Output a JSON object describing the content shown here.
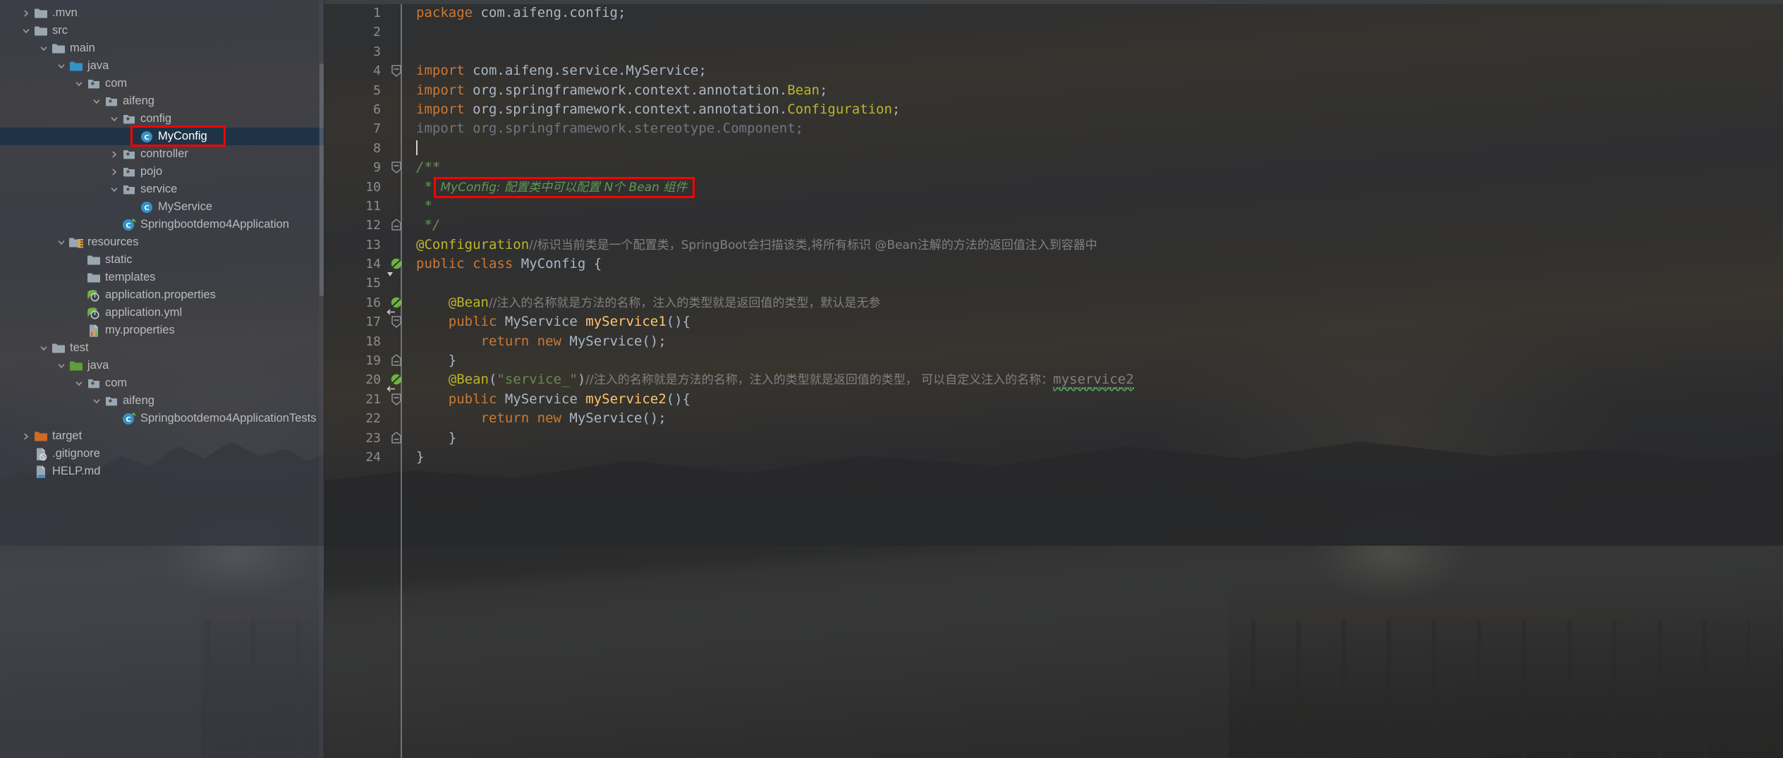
{
  "theme": {
    "sidebar_bg": "#3c3f47",
    "editor_bg": "#2b2b2b",
    "selection_bg": "#1f3347",
    "highlight_box": "#ff0000",
    "keyword": "#cc7832",
    "annotation": "#bbb529",
    "string": "#6a8759",
    "javadoc": "#629755",
    "comment": "#808080",
    "method": "#ffc66d",
    "identifier": "#a9b7c6",
    "line_number": "#8d8d8d"
  },
  "sidebar": {
    "name": "project-tree",
    "scrollbar": "visible",
    "items": [
      {
        "label": ".mvn",
        "indent": 1,
        "arrow": "collapsed",
        "icon": "folder-grey",
        "selected": false
      },
      {
        "label": "src",
        "indent": 1,
        "arrow": "expanded",
        "icon": "folder-grey",
        "selected": false
      },
      {
        "label": "main",
        "indent": 2,
        "arrow": "expanded",
        "icon": "folder-grey",
        "selected": false
      },
      {
        "label": "java",
        "indent": 3,
        "arrow": "expanded",
        "icon": "folder-blue",
        "selected": false
      },
      {
        "label": "com",
        "indent": 4,
        "arrow": "expanded",
        "icon": "package",
        "selected": false
      },
      {
        "label": "aifeng",
        "indent": 5,
        "arrow": "expanded",
        "icon": "package",
        "selected": false
      },
      {
        "label": "config",
        "indent": 6,
        "arrow": "expanded",
        "icon": "package",
        "selected": false
      },
      {
        "label": "MyConfig",
        "indent": 7,
        "arrow": "none",
        "icon": "java-class",
        "selected": true
      },
      {
        "label": "controller",
        "indent": 6,
        "arrow": "collapsed",
        "icon": "package",
        "selected": false
      },
      {
        "label": "pojo",
        "indent": 6,
        "arrow": "collapsed",
        "icon": "package",
        "selected": false
      },
      {
        "label": "service",
        "indent": 6,
        "arrow": "expanded",
        "icon": "package",
        "selected": false
      },
      {
        "label": "MyService",
        "indent": 7,
        "arrow": "none",
        "icon": "java-class",
        "selected": false
      },
      {
        "label": "Springbootdemo4Application",
        "indent": 6,
        "arrow": "none",
        "icon": "spring-boot-class",
        "selected": false
      },
      {
        "label": "resources",
        "indent": 3,
        "arrow": "expanded",
        "icon": "folder-resources",
        "selected": false
      },
      {
        "label": "static",
        "indent": 4,
        "arrow": "none",
        "icon": "folder-grey",
        "selected": false
      },
      {
        "label": "templates",
        "indent": 4,
        "arrow": "none",
        "icon": "folder-grey",
        "selected": false
      },
      {
        "label": "application.properties",
        "indent": 4,
        "arrow": "none",
        "icon": "spring-file",
        "selected": false
      },
      {
        "label": "application.yml",
        "indent": 4,
        "arrow": "none",
        "icon": "spring-file",
        "selected": false
      },
      {
        "label": "my.properties",
        "indent": 4,
        "arrow": "none",
        "icon": "properties-file",
        "selected": false
      },
      {
        "label": "test",
        "indent": 2,
        "arrow": "expanded",
        "icon": "folder-grey",
        "selected": false
      },
      {
        "label": "java",
        "indent": 3,
        "arrow": "expanded",
        "icon": "folder-green",
        "selected": false
      },
      {
        "label": "com",
        "indent": 4,
        "arrow": "expanded",
        "icon": "package",
        "selected": false
      },
      {
        "label": "aifeng",
        "indent": 5,
        "arrow": "expanded",
        "icon": "package",
        "selected": false
      },
      {
        "label": "Springbootdemo4ApplicationTests",
        "indent": 6,
        "arrow": "none",
        "icon": "spring-boot-class",
        "selected": false
      },
      {
        "label": "target",
        "indent": 1,
        "arrow": "collapsed",
        "icon": "folder-orange",
        "selected": false
      },
      {
        "label": ".gitignore",
        "indent": 1,
        "arrow": "none",
        "icon": "gitignore-file",
        "selected": false
      },
      {
        "label": "HELP.md",
        "indent": 1,
        "arrow": "none",
        "icon": "markdown-file",
        "selected": false
      }
    ]
  },
  "editor": {
    "name": "code-editor",
    "file": "MyConfig.java",
    "line_numbers": [
      1,
      2,
      3,
      4,
      5,
      6,
      7,
      8,
      9,
      10,
      11,
      12,
      13,
      14,
      15,
      16,
      17,
      18,
      19,
      20,
      21,
      22,
      23,
      24
    ],
    "bean_gutter_lines": [
      14,
      16,
      20
    ],
    "fold_lines": [
      4,
      9,
      12,
      17,
      19,
      21,
      23
    ],
    "caret_line": 8,
    "highlighted_comment_line": 10,
    "lines": {
      "l1_kw": "package",
      "l1_rest": " com.aifeng.config;",
      "l4_kw": "import",
      "l4_rest": " com.aifeng.service.MyService;",
      "l5_kw": "import",
      "l5_rest": " org.springframework.context.annotation.",
      "l5_type": "Bean",
      "l5_end": ";",
      "l6_kw": "import",
      "l6_rest": " org.springframework.context.annotation.",
      "l6_type": "Configuration",
      "l6_end": ";",
      "l7_all": "import org.springframework.stereotype.Component;",
      "l9": "/**",
      "l10_star": "*",
      "l10_text": "MyConfig: 配置类中可以配置 N个 Bean 组件",
      "l11_star": "*",
      "l12": "*/",
      "l13_ann": "@Configuration",
      "l13_cmt": "//标识当前类是一个配置类，SpringBoot会扫描该类,将所有标识 @Bean注解的方法的返回值注入到容器中",
      "l14_kw1": "public",
      "l14_kw2": "class",
      "l14_name": "MyConfig",
      "l14_brace": "{",
      "l16_ann": "@Bean",
      "l16_cmt": "//注入的名称就是方法的名称，注入的类型就是返回值的类型，默认是无参",
      "l17_kw": "public",
      "l17_type": "MyService",
      "l17_mth": "myService1",
      "l17_tail": "(){",
      "l18_kw1": "return",
      "l18_kw2": "new",
      "l18_type": "MyService",
      "l18_tail": "();",
      "l19": "}",
      "l20_ann": "@Bean",
      "l20_str": "\"service_\"",
      "l20_cmt": "//注入的名称就是方法的名称，注入的类型就是返回值的类型，",
      "l20_cmt2": "可以自定义注入的名称：",
      "l20_squig": "myservice2",
      "l21_kw": "public",
      "l21_type": "MyService",
      "l21_mth": "myService2",
      "l21_tail": "(){",
      "l22_kw1": "return",
      "l22_kw2": "new",
      "l22_type": "MyService",
      "l22_tail": "();",
      "l23": "}",
      "l24": "}"
    }
  }
}
